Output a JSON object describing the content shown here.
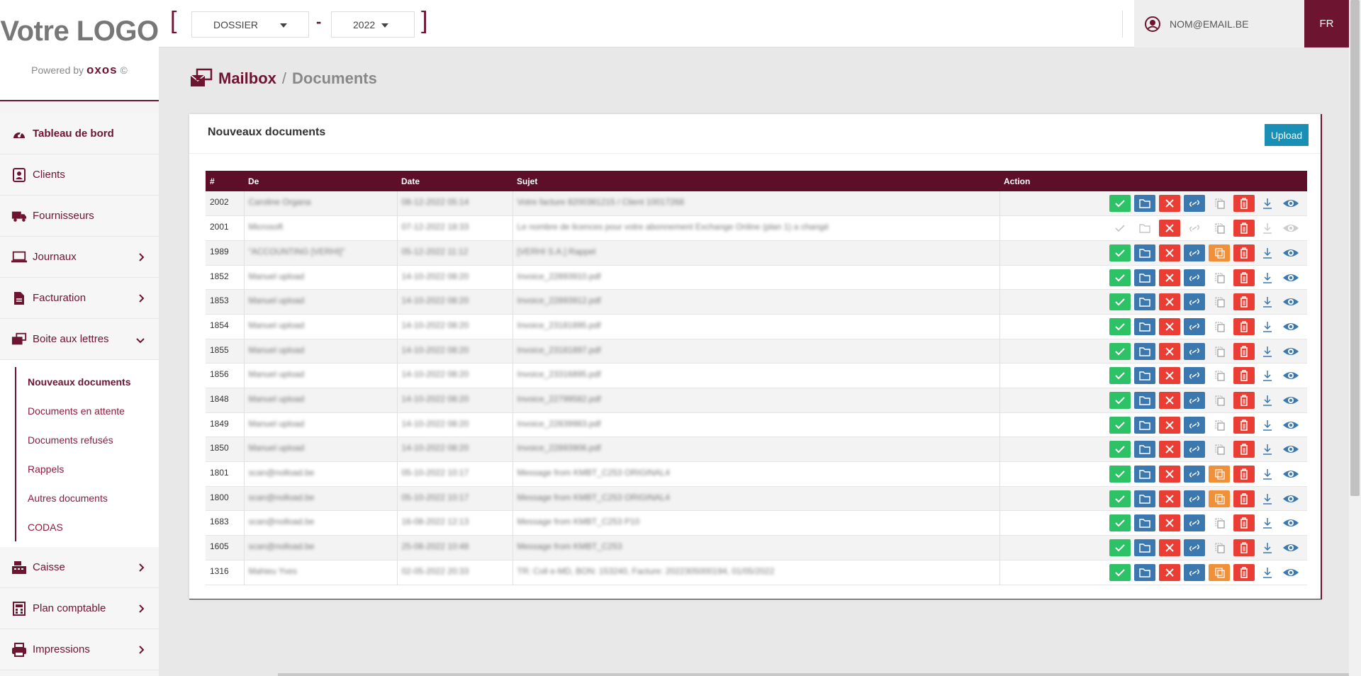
{
  "brand": {
    "logo": "Votre LOGO",
    "powered_by": "Powered by",
    "powered_brand": "oxos"
  },
  "topbar": {
    "dossier": "DOSSIER",
    "dash": "-",
    "year": "2022",
    "email": "NOM@EMAIL.BE",
    "lang": "FR"
  },
  "sidebar": {
    "items": [
      {
        "label": "Tableau de bord",
        "icon": "dashboard-icon"
      },
      {
        "label": "Clients",
        "icon": "contact-card-icon"
      },
      {
        "label": "Fournisseurs",
        "icon": "truck-icon"
      },
      {
        "label": "Journaux",
        "icon": "laptop-icon"
      },
      {
        "label": "Facturation",
        "icon": "file-icon"
      },
      {
        "label": "Boite aux lettres",
        "icon": "mailbox-icon"
      },
      {
        "label": "Caisse",
        "icon": "cash-register-icon"
      },
      {
        "label": "Plan comptable",
        "icon": "calculator-icon"
      },
      {
        "label": "Impressions",
        "icon": "printer-icon"
      }
    ],
    "sub": [
      "Nouveaux documents",
      "Documents en attente",
      "Documents refusés",
      "Rappels",
      "Autres documents",
      "CODAS"
    ]
  },
  "breadcrumb": {
    "section": "Mailbox",
    "separator": "/",
    "page": "Documents"
  },
  "panel": {
    "title": "Nouveaux documents",
    "upload": "Upload"
  },
  "table": {
    "headers": [
      "#",
      "De",
      "Date",
      "Sujet",
      "Action"
    ],
    "rows": [
      {
        "id": "2002",
        "from": "Caroline Organa",
        "date": "08-12-2022 05:14",
        "subject": "Votre facture 8200381215 / Client 10017268",
        "state": "full"
      },
      {
        "id": "2001",
        "from": "Microsoft",
        "date": "07-12-2022 18:33",
        "subject": "Le nombre de licences pour votre abonnement Exchange Online (plan 1) a changé",
        "state": "partial"
      },
      {
        "id": "1989",
        "from": "\"ACCOUNTING [VERHI]\"",
        "date": "05-12-2022 11:12",
        "subject": "[VERHI S.A.] Rappel",
        "state": "full-orange"
      },
      {
        "id": "1852",
        "from": "Manuel upload",
        "date": "14-10-2022 08:20",
        "subject": "Invoice_22893910.pdf",
        "state": "full"
      },
      {
        "id": "1853",
        "from": "Manuel upload",
        "date": "14-10-2022 08:20",
        "subject": "Invoice_22893912.pdf",
        "state": "full"
      },
      {
        "id": "1854",
        "from": "Manuel upload",
        "date": "14-10-2022 08:20",
        "subject": "Invoice_23181895.pdf",
        "state": "full"
      },
      {
        "id": "1855",
        "from": "Manuel upload",
        "date": "14-10-2022 08:20",
        "subject": "Invoice_23181897.pdf",
        "state": "full"
      },
      {
        "id": "1856",
        "from": "Manuel upload",
        "date": "14-10-2022 08:20",
        "subject": "Invoice_23316895.pdf",
        "state": "full"
      },
      {
        "id": "1848",
        "from": "Manuel upload",
        "date": "14-10-2022 08:20",
        "subject": "Invoice_22799582.pdf",
        "state": "full"
      },
      {
        "id": "1849",
        "from": "Manuel upload",
        "date": "14-10-2022 08:20",
        "subject": "Invoice_22839983.pdf",
        "state": "full"
      },
      {
        "id": "1850",
        "from": "Manuel upload",
        "date": "14-10-2022 08:20",
        "subject": "Invoice_22893906.pdf",
        "state": "full"
      },
      {
        "id": "1801",
        "from": "scan@nolload.be",
        "date": "05-10-2022 10:17",
        "subject": "Message from KMBT_C253 ORIGINAL4",
        "state": "full-orange"
      },
      {
        "id": "1800",
        "from": "scan@nolload.be",
        "date": "05-10-2022 10:17",
        "subject": "Message from KMBT_C253 ORIGINAL4",
        "state": "full-orange"
      },
      {
        "id": "1683",
        "from": "scan@nolload.be",
        "date": "16-08-2022 12:13",
        "subject": "Message from KMBT_C253 P10",
        "state": "full"
      },
      {
        "id": "1605",
        "from": "scan@nolload.be",
        "date": "25-08-2022 10:48",
        "subject": "Message from KMBT_C253",
        "state": "full"
      },
      {
        "id": "1316",
        "from": "Mahieu Yves",
        "date": "02-05-2022 20:33",
        "subject": "TR: Coll e-MD, BON: 153240, Facture: 2022305000194, 01/05/2022",
        "state": "full-orange"
      }
    ]
  },
  "colors": {
    "accent": "#6d1530",
    "header": "#5d0f2a",
    "green": "#2ec267",
    "blue": "#3b78b0",
    "red": "#ea3e34",
    "orange": "#f0913a",
    "upload": "#1a8fb5"
  }
}
